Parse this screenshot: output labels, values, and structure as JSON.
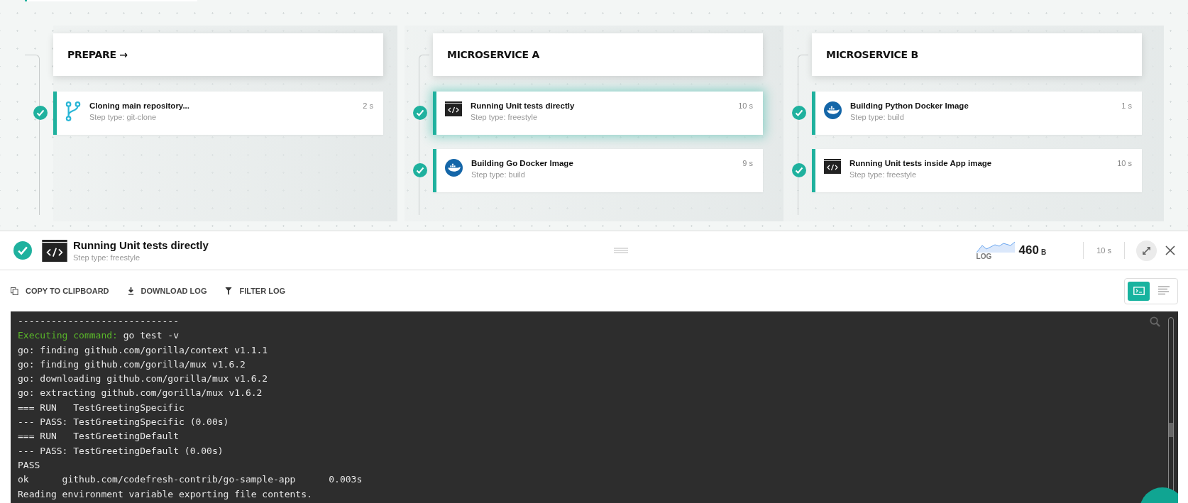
{
  "stages": [
    {
      "title": "PREPARE →",
      "steps": [
        {
          "kind": "git",
          "name": "Cloning main repository...",
          "step_type": "Step type: git-clone",
          "duration": "2 s",
          "selected": false,
          "success": true
        }
      ]
    },
    {
      "title": "MICROSERVICE A",
      "steps": [
        {
          "kind": "freestyle",
          "name": "Running Unit tests directly",
          "step_type": "Step type: freestyle",
          "duration": "10 s",
          "selected": true,
          "success": true
        },
        {
          "kind": "docker",
          "name": "Building Go Docker Image",
          "step_type": "Step type: build",
          "duration": "9 s",
          "selected": false,
          "success": true
        }
      ]
    },
    {
      "title": "MICROSERVICE B",
      "steps": [
        {
          "kind": "docker",
          "name": "Building Python Docker Image",
          "step_type": "Step type: build",
          "duration": "1 s",
          "selected": false,
          "success": true
        },
        {
          "kind": "freestyle",
          "name": "Running Unit tests inside App image",
          "step_type": "Step type: freestyle",
          "duration": "10 s",
          "selected": false,
          "success": true
        }
      ]
    }
  ],
  "detail": {
    "kind": "freestyle",
    "success": true,
    "title": "Running Unit tests directly",
    "step_type": "Step type: freestyle",
    "log_label": "LOG",
    "log_size": "460",
    "log_unit": "B",
    "duration": "10 s"
  },
  "toolbar": [
    {
      "kind": "copy",
      "label": "COPY TO CLIPBOARD"
    },
    {
      "kind": "download",
      "label": "DOWNLOAD LOG"
    },
    {
      "kind": "filter",
      "label": "FILTER LOG"
    }
  ],
  "view_toggle": [
    {
      "kind": "terminal",
      "selected": true
    },
    {
      "kind": "text",
      "selected": false
    }
  ],
  "log_lines": [
    {
      "text": "-----------------------------"
    },
    {
      "prefix": "Executing command:",
      "text": " go test -v"
    },
    {
      "text": "go: finding github.com/gorilla/context v1.1.1"
    },
    {
      "text": "go: finding github.com/gorilla/mux v1.6.2"
    },
    {
      "text": "go: downloading github.com/gorilla/mux v1.6.2"
    },
    {
      "text": "go: extracting github.com/gorilla/mux v1.6.2"
    },
    {
      "text": "=== RUN   TestGreetingSpecific"
    },
    {
      "text": "--- PASS: TestGreetingSpecific (0.00s)"
    },
    {
      "text": "=== RUN   TestGreetingDefault"
    },
    {
      "text": "--- PASS: TestGreetingDefault (0.00s)"
    },
    {
      "text": "PASS"
    },
    {
      "text": "ok      github.com/codefresh-contrib/go-sample-app      0.003s"
    },
    {
      "text": "Reading environment variable exporting file contents."
    }
  ]
}
